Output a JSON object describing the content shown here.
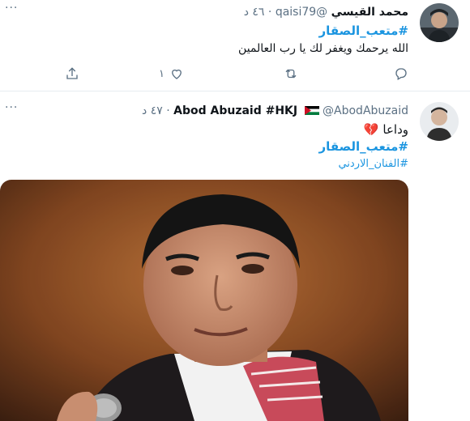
{
  "tweets": [
    {
      "author_name": "محمد القيسي",
      "author_handle": "@qaisi79",
      "separator": "·",
      "time": "٤٦ د",
      "hashtag": "#متعب_الصقار",
      "text": "الله يرحمك ويغفر لك يا رب العالمين",
      "like_count": "١",
      "more_label": "···"
    },
    {
      "author_name": "Abod Abuzaid #HKJ",
      "author_handle": "@AbodAbuzaid",
      "separator": "·",
      "time": "٤٧ د",
      "flag_icon": "jordan-flag-icon",
      "text": "وداعا",
      "emoji": "💔",
      "hashtag": "#متعب_الصقار",
      "hashtag_secondary": "#الفنان_الاردني",
      "more_label": "···"
    }
  ],
  "colors": {
    "accent": "#1b95e0",
    "secondary_text": "#5b7083",
    "border": "#e6ecf0"
  }
}
